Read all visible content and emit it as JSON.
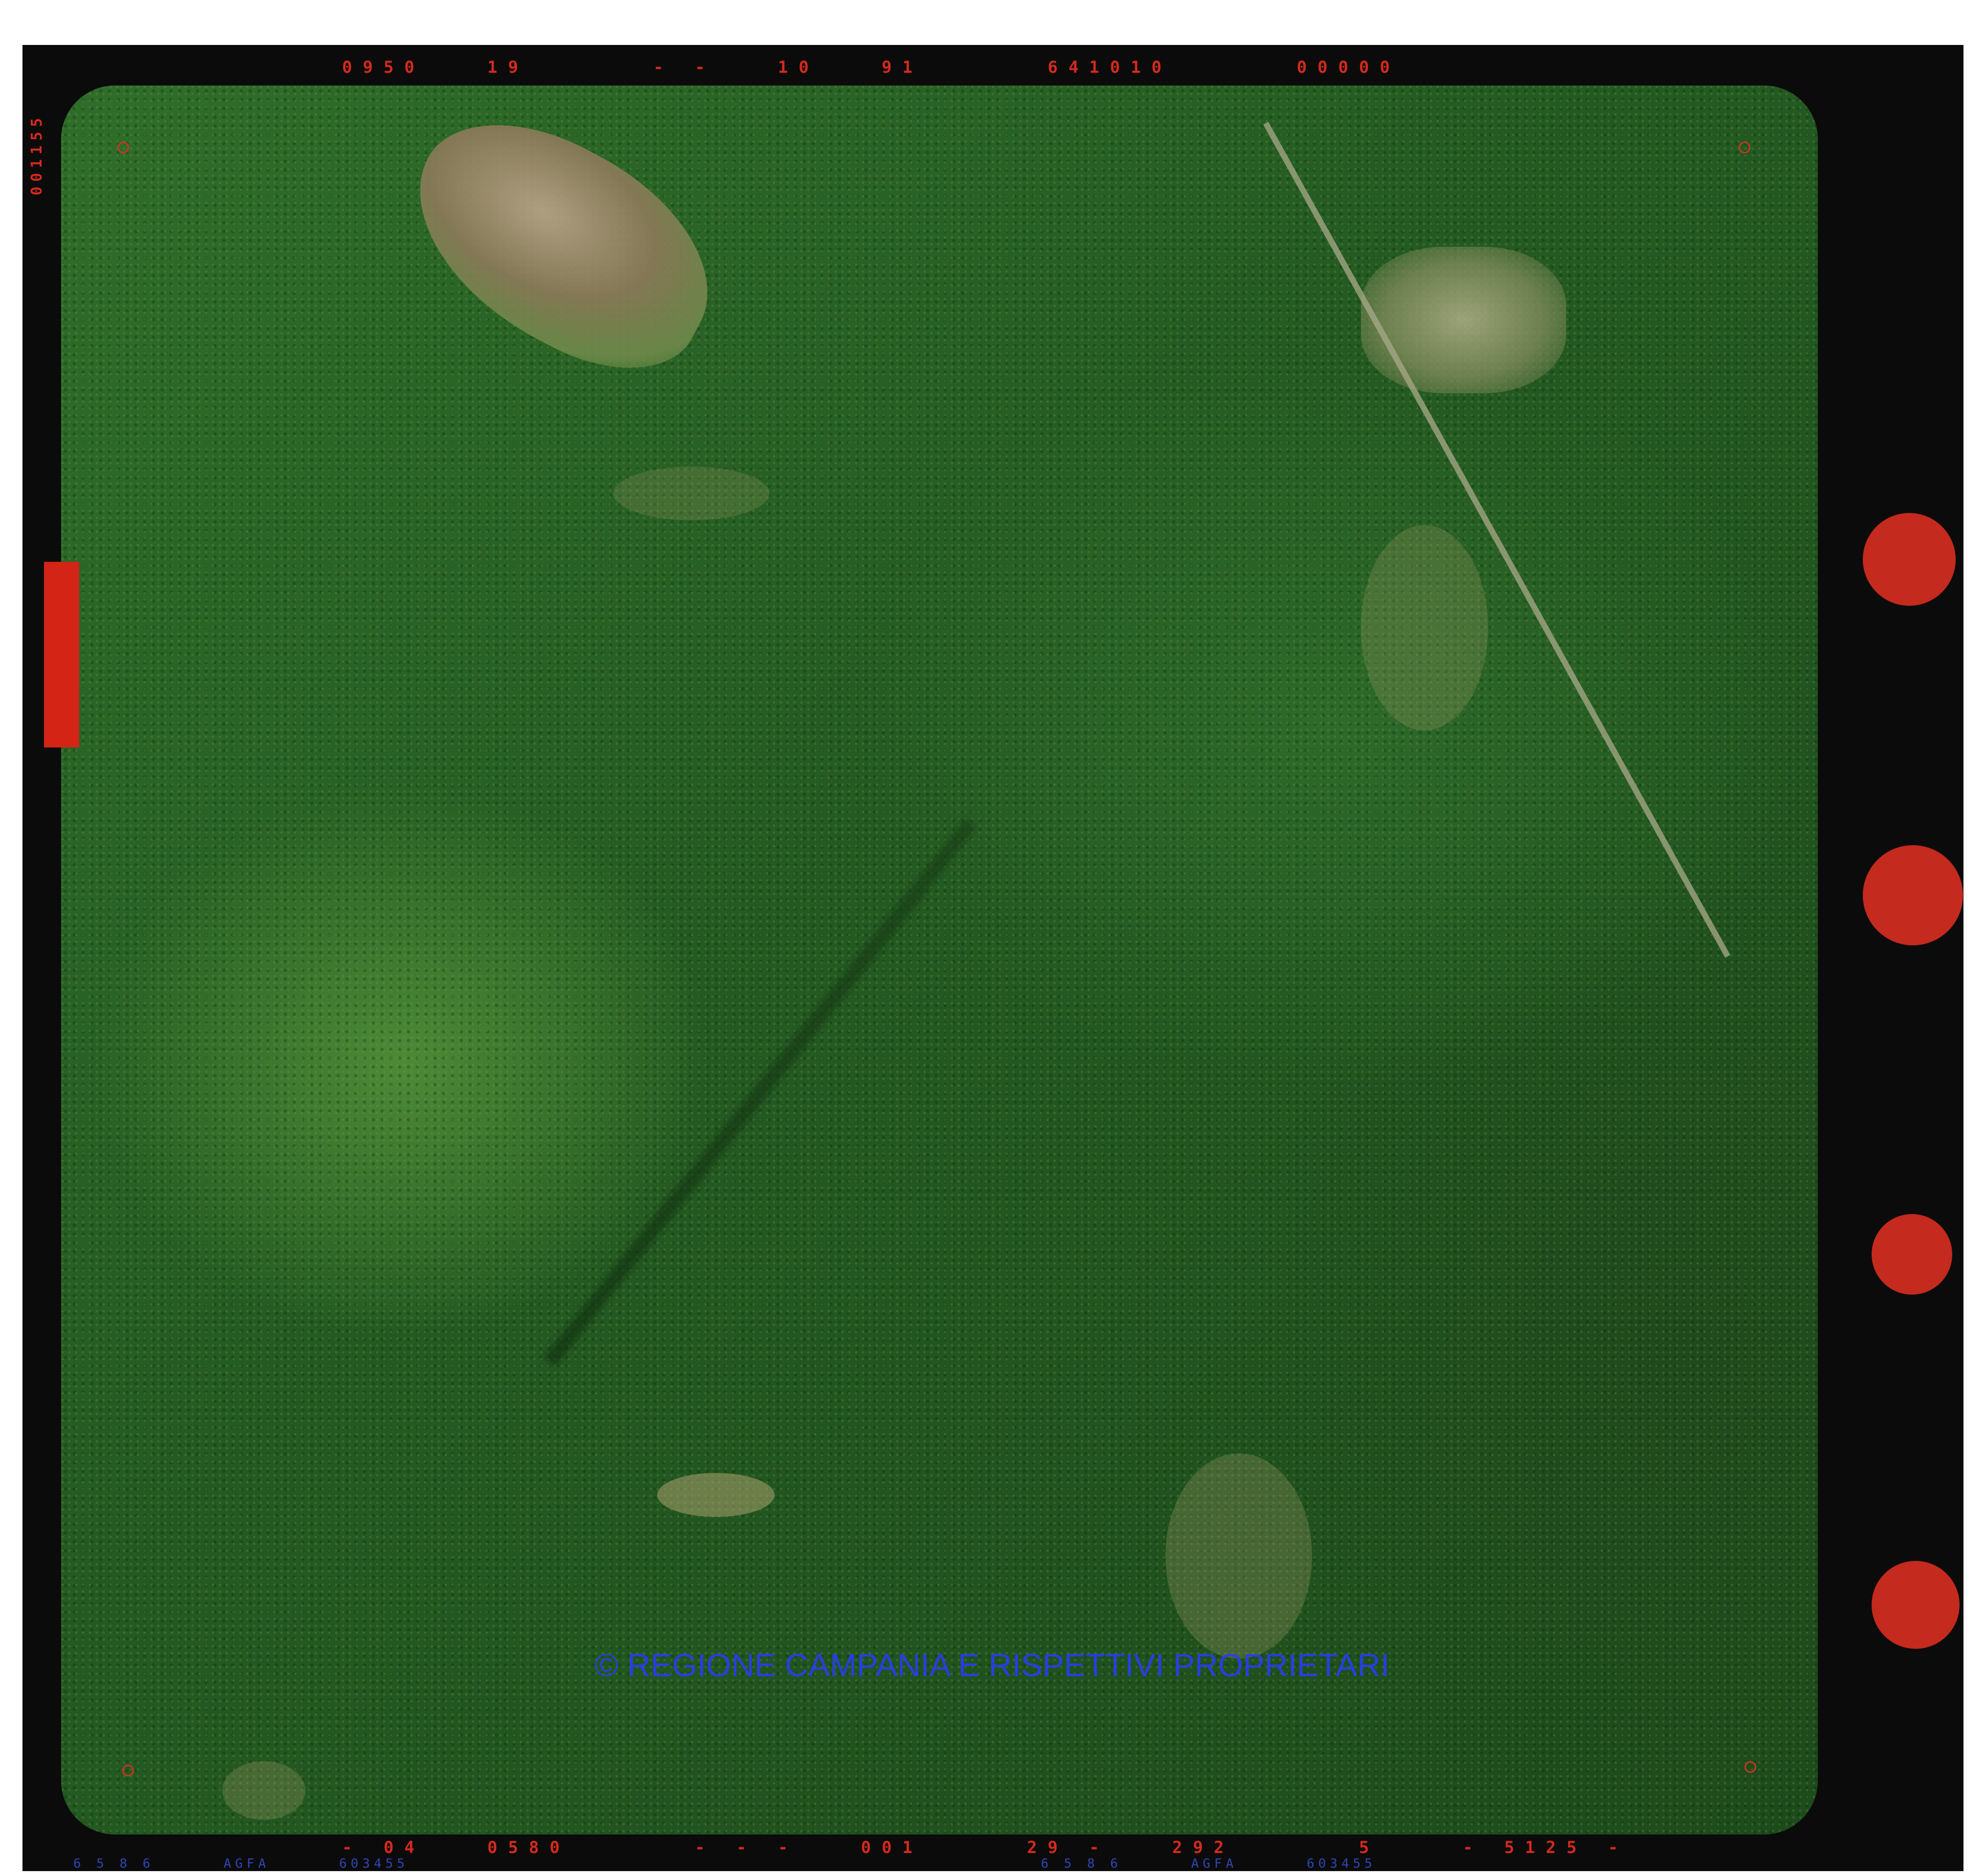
{
  "photo": {
    "subject": "aerial-forest-photograph"
  },
  "film": {
    "top_strip": "0950   19      - -   10   91      641010      00000",
    "side_number": "001155",
    "bottom_strip": "- 04   0580      - - -   001     29 -   292      5    - 5125 -",
    "edge_print_left": "6 5 8 6      AGFA      603455",
    "edge_print_right": "6 5 8 6      AGFA      603455"
  },
  "watermark": {
    "text": "© REGIONE CAMPANIA E RISPETTIVI PROPRIETARI"
  },
  "colors": {
    "film_border": "#0b0b0b",
    "data_text": "#d42a1d",
    "marker": "#c42a1e",
    "watermark": "#2f46b0",
    "forest": "#245a22"
  }
}
